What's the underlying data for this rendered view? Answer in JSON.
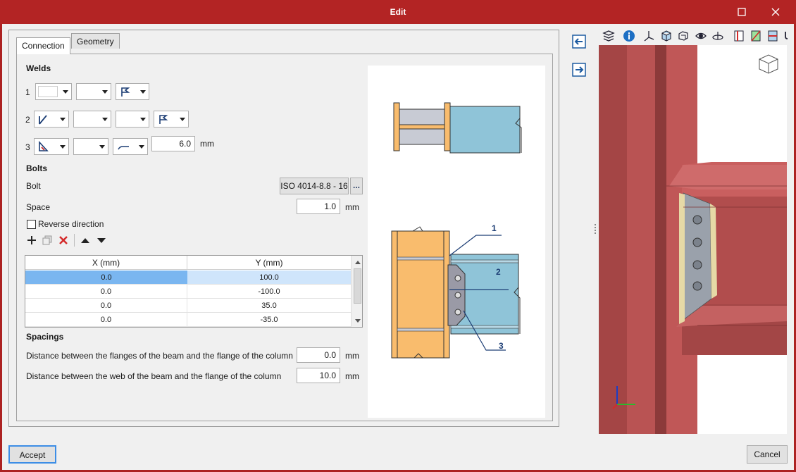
{
  "window": {
    "title": "Edit",
    "maximize_icon": "maximize-icon",
    "close_icon": "close-icon"
  },
  "tabs": [
    {
      "label": "Connection"
    },
    {
      "label": "Geometry"
    }
  ],
  "welds": {
    "heading": "Welds",
    "rows": [
      {
        "num": "1"
      },
      {
        "num": "2"
      },
      {
        "num": "3",
        "value": "6.0",
        "unit": "mm"
      }
    ]
  },
  "bolts": {
    "heading": "Bolts",
    "bolt_label": "Bolt",
    "bolt_value": "ISO 4014-8.8 - 16",
    "bolt_more": "...",
    "space_label": "Space",
    "space_value": "1.0",
    "space_unit": "mm",
    "reverse_label": "Reverse direction",
    "reverse_checked": false
  },
  "table": {
    "columns": [
      "X (mm)",
      "Y (mm)"
    ],
    "rows": [
      [
        "0.0",
        "100.0"
      ],
      [
        "0.0",
        "-100.0"
      ],
      [
        "0.0",
        "35.0"
      ],
      [
        "0.0",
        "-35.0"
      ]
    ],
    "selected_row": 0
  },
  "spacings": {
    "heading": "Spacings",
    "flange_label": "Distance between the flanges of the beam and the flange of the column",
    "flange_value": "0.0",
    "flange_unit": "mm",
    "web_label": "Distance between the web of the beam and the flange of the column",
    "web_value": "10.0",
    "web_unit": "mm"
  },
  "diagram_labels": {
    "one": "1",
    "two": "2",
    "three": "3"
  },
  "buttons": {
    "accept": "Accept",
    "cancel": "Cancel"
  },
  "colors": {
    "titlebar": "#b32424",
    "column": "#f9bc6d",
    "beam": "#8fc4d8",
    "steel3d": "#b95353",
    "plate": "#9a9aa6",
    "selection": "#7ab6f0"
  }
}
